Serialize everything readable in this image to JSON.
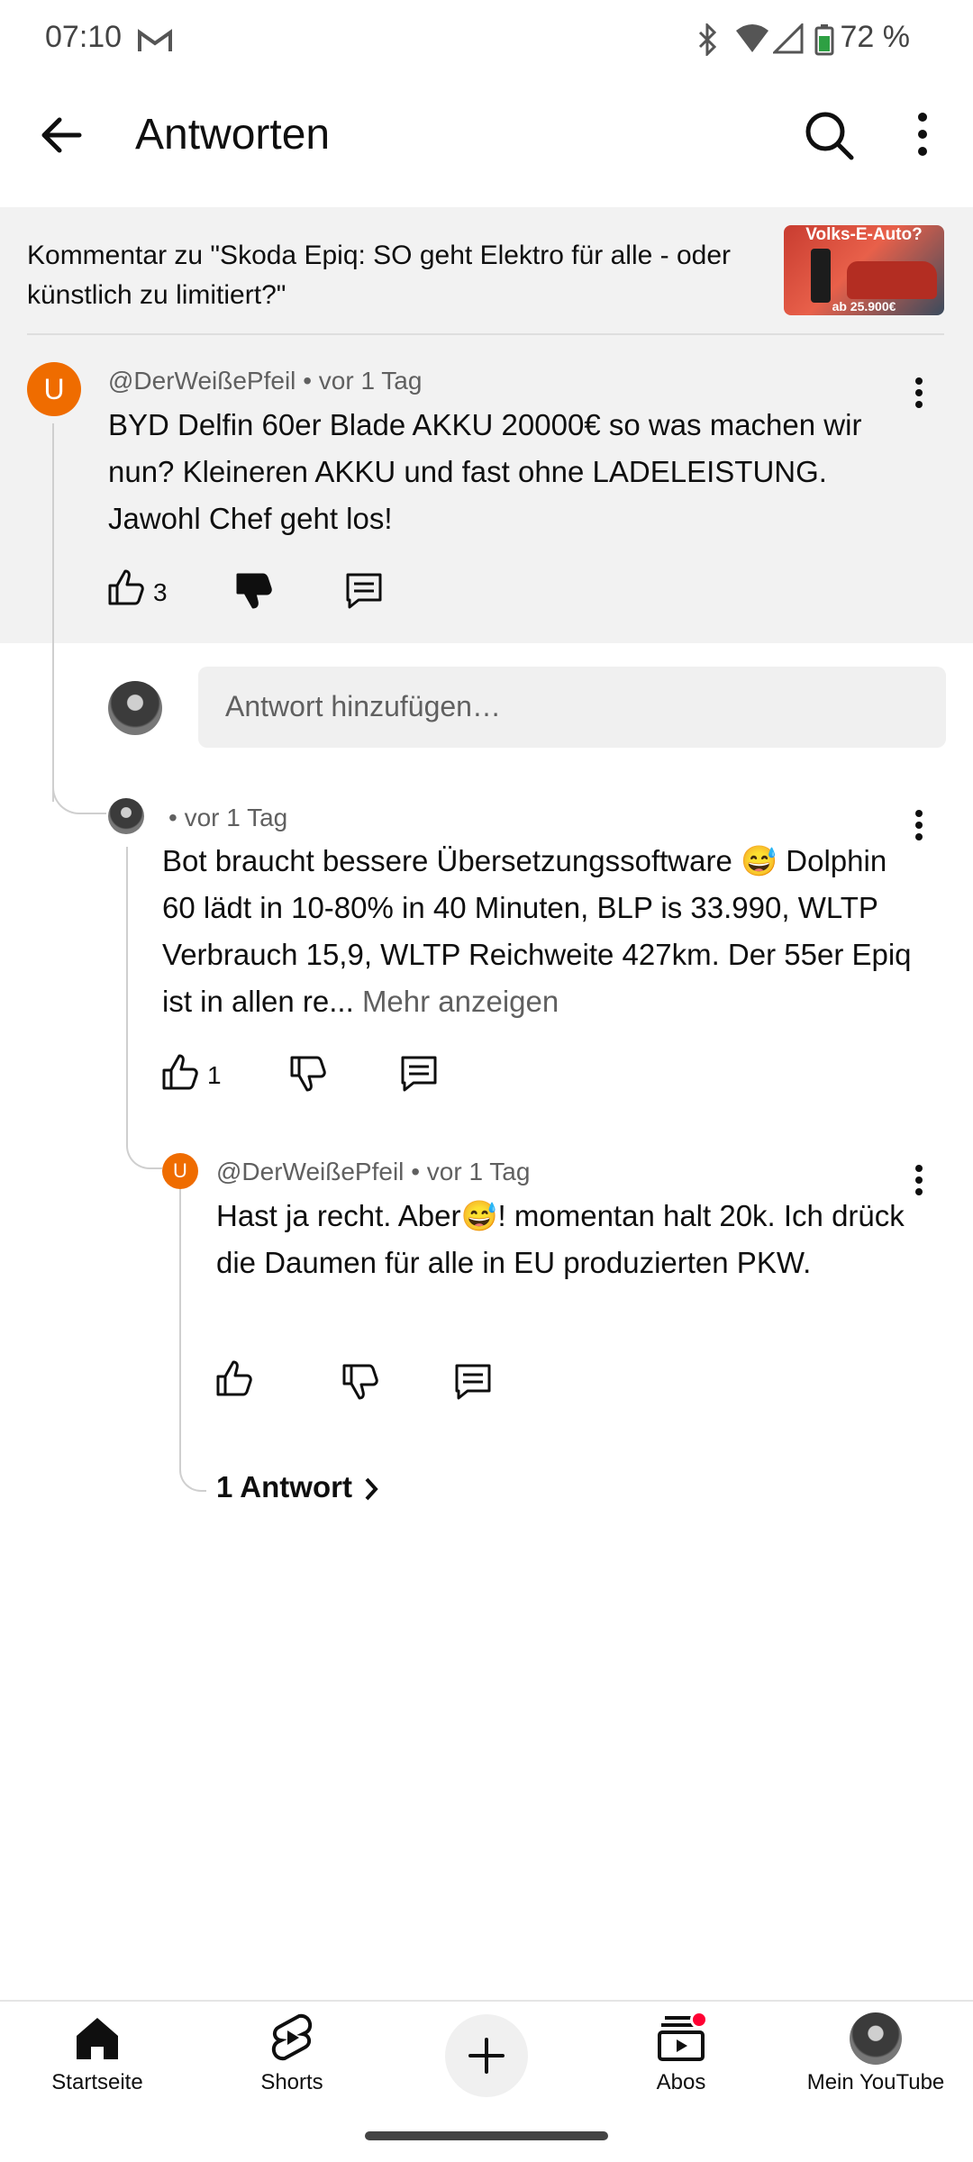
{
  "status_bar": {
    "time": "07:10",
    "battery": "72 %"
  },
  "header": {
    "title": "Antworten"
  },
  "context": {
    "text": "Kommentar zu \"Skoda Epiq: SO geht Elektro für alle - oder künstlich zu limitiert?\"",
    "thumbnail_top": "Volks-E-Auto?",
    "thumbnail_bottom": "ab 25.900€"
  },
  "comments": [
    {
      "avatar_letter": "U",
      "author": "@DerWeißePfeil",
      "time": "• vor 1 Tag",
      "text": "BYD Delfin 60er Blade AKKU 20000€ so was machen wir nun? Kleineren AKKU und fast ohne LADELEISTUNG. Jawohl Chef geht los!",
      "likes": "3"
    },
    {
      "author": "",
      "time": "• vor 1 Tag",
      "text": "Bot braucht bessere Übersetzungssoftware 😅 Dolphin 60 lädt in 10-80% in 40 Minuten, BLP is 33.990, WLTP Verbrauch 15,9, WLTP Reichweite 427km. Der 55er Epiq ist in allen re...",
      "more_label": "Mehr anzeigen",
      "likes": "1"
    },
    {
      "avatar_letter": "U",
      "author": "@DerWeißePfeil",
      "time": "• vor 1 Tag",
      "text": "Hast ja recht. Aber😅! momentan halt 20k. Ich drück die Daumen für alle in EU produzierten PKW.",
      "likes": ""
    }
  ],
  "reply_input": {
    "placeholder": "Antwort hinzufügen…"
  },
  "more_replies": "1 Antwort",
  "bottom_nav": [
    {
      "label": "Startseite",
      "icon": "home-icon"
    },
    {
      "label": "Shorts",
      "icon": "shorts-icon"
    },
    {
      "label": "",
      "icon": "create-icon"
    },
    {
      "label": "Abos",
      "icon": "subscriptions-icon"
    },
    {
      "label": "Mein YouTube",
      "icon": "avatar"
    }
  ],
  "colors": {
    "accent_orange": "#ef6c00",
    "notification_red": "#ff0033",
    "context_bg": "#f2f2f2"
  }
}
